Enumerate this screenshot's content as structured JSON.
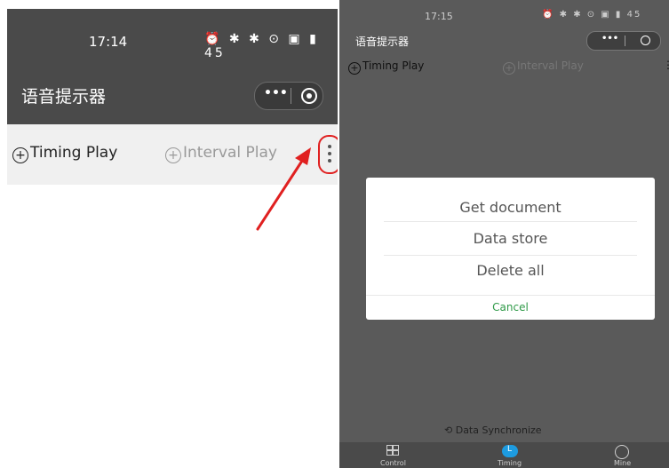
{
  "left": {
    "status": {
      "time": "17:14",
      "signal_icons": "⏰ ✱ ✱ ⊙ ▣ ▮ 45"
    },
    "nav": {
      "title": "语音提示器",
      "capsule_dots": "•••"
    },
    "tabs": {
      "timing": "Timing Play",
      "interval": "Interval Play"
    }
  },
  "right": {
    "status": {
      "time": "17:15",
      "signal_icons": "⏰ ✱ ✱ ⊙ ▣ ▮ 45"
    },
    "nav": {
      "title": "语音提示器",
      "capsule_dots": "•••"
    },
    "tabs": {
      "timing": "Timing Play",
      "interval": "Interval Play",
      "menu": "⋮"
    },
    "dialog": {
      "items": [
        "Get document",
        "Data store",
        "Delete all"
      ],
      "cancel": "Cancel"
    },
    "sync_label": "Data Synchronize",
    "bottom_nav": [
      "Control",
      "Timing",
      "Mine"
    ]
  },
  "colors": {
    "accent_red": "#e02020",
    "cancel_green": "#2f9a48",
    "timing_blue": "#1d9be0"
  }
}
